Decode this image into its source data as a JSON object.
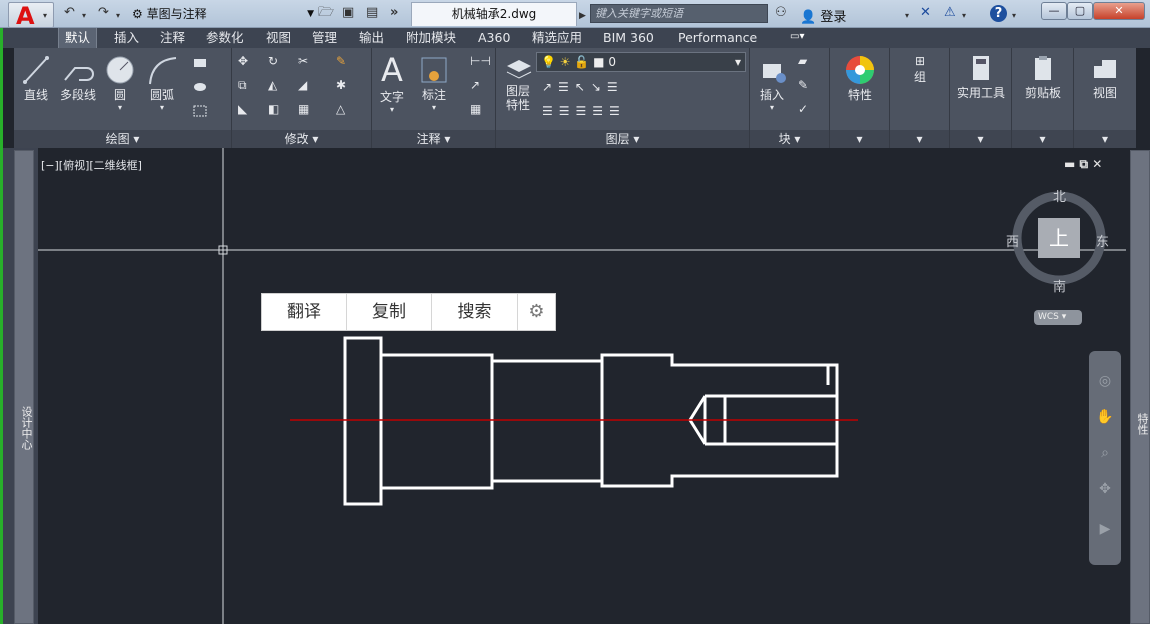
{
  "titlebar": {
    "workspace": "草图与注释",
    "document_tab": "机械轴承2.dwg",
    "search_placeholder": "键入关键字或短语",
    "login": "登录",
    "colors": {
      "brand": "#d11111",
      "close": "#c7412a"
    }
  },
  "tabs": [
    {
      "label": "默认",
      "active": true
    },
    {
      "label": "插入"
    },
    {
      "label": "注释"
    },
    {
      "label": "参数化"
    },
    {
      "label": "视图"
    },
    {
      "label": "管理"
    },
    {
      "label": "输出"
    },
    {
      "label": "附加模块"
    },
    {
      "label": "A360"
    },
    {
      "label": "精选应用"
    },
    {
      "label": "BIM 360"
    },
    {
      "label": "Performance"
    }
  ],
  "ribbon": {
    "draw": {
      "title": "绘图",
      "line": "直线",
      "polyline": "多段线",
      "circle": "圆",
      "arc": "圆弧"
    },
    "modify": {
      "title": "修改"
    },
    "annotation": {
      "title": "注释",
      "text": "文字",
      "dimension": "标注"
    },
    "layers": {
      "title": "图层",
      "layer_props_line1": "图层",
      "layer_props_line2": "特性",
      "current_layer": "0"
    },
    "block": {
      "title": "块",
      "insert": "插入"
    },
    "properties": {
      "label": "特性"
    },
    "groups": {
      "label": "组"
    },
    "utilities": {
      "label": "实用工具"
    },
    "clipboard": {
      "label": "剪贴板"
    },
    "view": {
      "label": "视图"
    }
  },
  "canvas": {
    "viewport_label": "[−][俯视][二维线框]",
    "compass": {
      "north": "北",
      "south": "南",
      "east": "东",
      "west": "西",
      "top": "上"
    },
    "wcs": "WCS",
    "left_palette": "设计中心",
    "right_palette": "特性",
    "centerline_color": "#c00000"
  },
  "popup": {
    "translate": "翻译",
    "copy": "复制",
    "search": "搜索"
  }
}
